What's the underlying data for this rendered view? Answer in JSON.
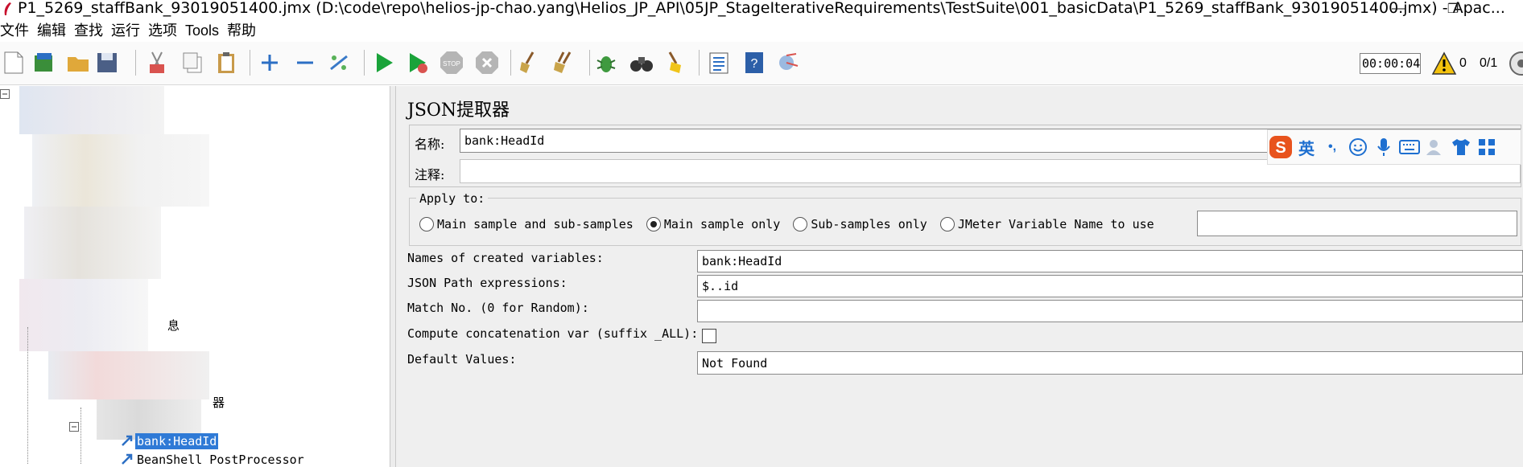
{
  "window": {
    "title": "P1_5269_staffBank_93019051400.jmx (D:\\code\\repo\\helios-jp-chao.yang\\Helios_JP_API\\05JP_StageIterativeRequirements\\TestSuite\\001_basicData\\P1_5269_staffBank_93019051400.jmx) - Apac...",
    "minimize": "—",
    "restore": "❐"
  },
  "menu": [
    "文件",
    "编辑",
    "查找",
    "运行",
    "选项",
    "Tools",
    "帮助"
  ],
  "toolbar": {
    "timer": "00:00:04",
    "error_count": "0",
    "threads": "0/1"
  },
  "tree": {
    "partial_label_1": "息",
    "partial_label_2": "器",
    "selected_item": "bank:HeadId",
    "next_item": "BeanShell PostProcessor"
  },
  "editor": {
    "title": "JSON提取器",
    "name_label": "名称:",
    "name_value": "bank:HeadId",
    "comment_label": "注释:",
    "comment_value": "",
    "apply_to": {
      "legend": "Apply to:",
      "options": [
        {
          "label": "Main sample and sub-samples",
          "selected": false
        },
        {
          "label": "Main sample only",
          "selected": true
        },
        {
          "label": "Sub-samples only",
          "selected": false
        },
        {
          "label": "JMeter Variable Name to use",
          "selected": false
        }
      ],
      "variable_name_value": ""
    },
    "fields": {
      "names_label": "Names of created variables:",
      "names_value": "bank:HeadId",
      "jsonpath_label": "JSON Path expressions:",
      "jsonpath_value": "$..id",
      "match_label": "Match No. (0 for Random):",
      "match_value": "",
      "concat_label": "Compute concatenation var (suffix _ALL):",
      "concat_checked": false,
      "default_label": "Default Values:",
      "default_value": "Not Found"
    }
  },
  "ime": {
    "logo": "S",
    "lang": "英",
    "punct": "•,"
  },
  "colors": {
    "accent": "#2f7ad6",
    "run_green": "#1aa33a",
    "panel_bg": "#efefef",
    "ime_logo": "#e8531d"
  }
}
